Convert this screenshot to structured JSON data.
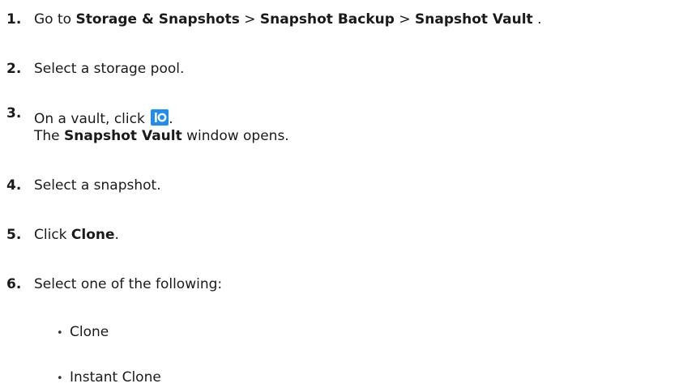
{
  "steps": [
    {
      "number": "1.",
      "text_1": "Go to ",
      "bold_1": "Storage & Snapshots",
      "sep_1": " > ",
      "bold_2": "Snapshot Backup",
      "sep_2": " > ",
      "bold_3": "Snapshot Vault",
      "end": " ."
    },
    {
      "number": "2.",
      "text": "Select a storage pool."
    },
    {
      "number": "3.",
      "text_1": "On a vault, click ",
      "icon": "snapshot-vault-icon",
      "after_icon": ".",
      "line2_bold": "Snapshot Vault",
      "line2_text": " window opens.",
      "line2_prefix": "The "
    },
    {
      "number": "4.",
      "text": "Select a snapshot."
    },
    {
      "number": "5.",
      "text_1": "Click ",
      "bold_1": "Clone",
      "end": "."
    },
    {
      "number": "6.",
      "text": "Select one of the following:"
    }
  ],
  "options": [
    {
      "bullet": "•",
      "label": "Clone"
    },
    {
      "bullet": "•",
      "label": "Instant Clone"
    }
  ],
  "colors": {
    "icon_bg": "#1e8cf0",
    "text": "#1a1a1a"
  }
}
